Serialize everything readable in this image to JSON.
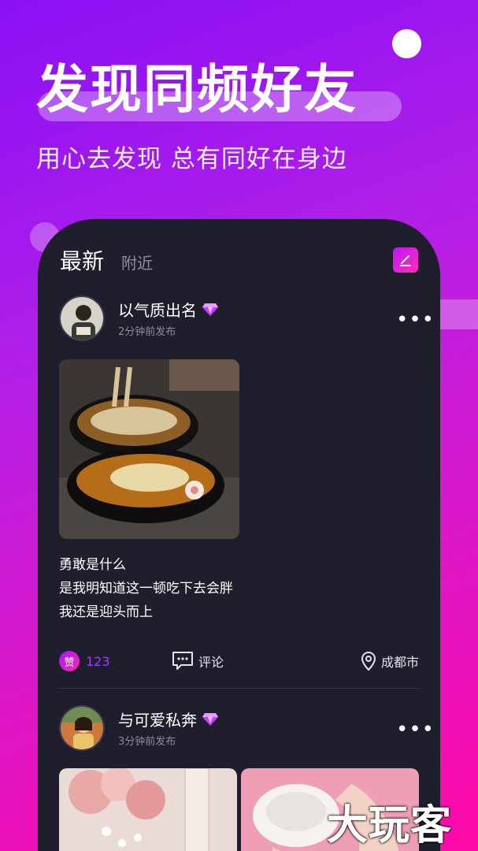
{
  "hero": {
    "title": "发现同频好友",
    "subtitle": "用心去发现 总有同好在身边"
  },
  "tabs": [
    "最新",
    "附近"
  ],
  "posts": [
    {
      "username": "以气质出名",
      "time": "2分钟前发布",
      "caption_lines": [
        "勇敢是什么",
        "是我明知道这一顿吃下去会胖",
        "我还是迎头而上"
      ],
      "like_badge": "赞",
      "like_count": "123",
      "comment_label": "评论",
      "location": "成都市"
    },
    {
      "username": "与可爱私奔",
      "time": "3分钟前发布"
    }
  ],
  "watermark": "大玩客",
  "colors": {
    "accent": "#a615ff",
    "accent2": "#ff2aa6",
    "card_bg": "#1f1e2d"
  }
}
